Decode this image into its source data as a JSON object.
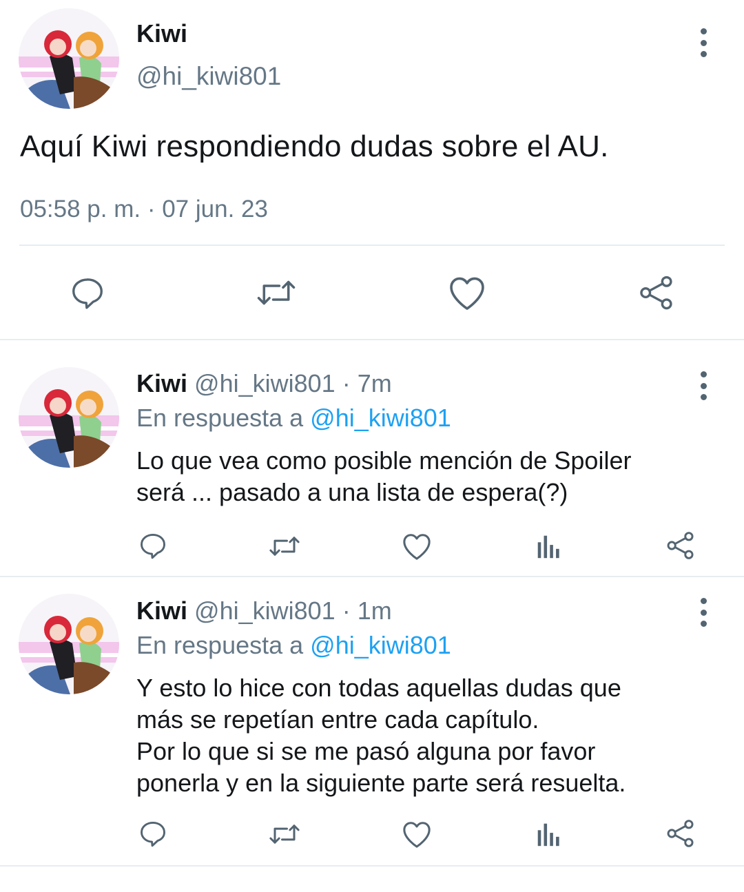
{
  "main_tweet": {
    "name": "Kiwi",
    "handle": "@hi_kiwi801",
    "text": "Aquí Kiwi respondiendo dudas sobre el AU.",
    "timestamp": "05:58 p. m. · 07 jun. 23"
  },
  "replies": [
    {
      "name": "Kiwi",
      "handle": "@hi_kiwi801",
      "time": "· 7m",
      "in_reply_prefix": "En respuesta a",
      "in_reply_handle": "@hi_kiwi801",
      "text": "Lo que vea como posible mención de Spoiler\nserá ... pasado a una lista de espera(?)"
    },
    {
      "name": "Kiwi",
      "handle": "@hi_kiwi801",
      "time": "· 1m",
      "in_reply_prefix": "En respuesta a",
      "in_reply_handle": "@hi_kiwi801",
      "text": "Y esto lo hice con todas aquellas dudas que\nmás se repetían entre cada capítulo.\nPor lo que si se me pasó alguna por favor\nponerla y en la siguiente parte será resuelta."
    }
  ],
  "colors": {
    "text": "#14171a",
    "secondary": "#657786",
    "link": "#1da1f2",
    "icon": "#536471",
    "divider": "#e6ecf0"
  }
}
